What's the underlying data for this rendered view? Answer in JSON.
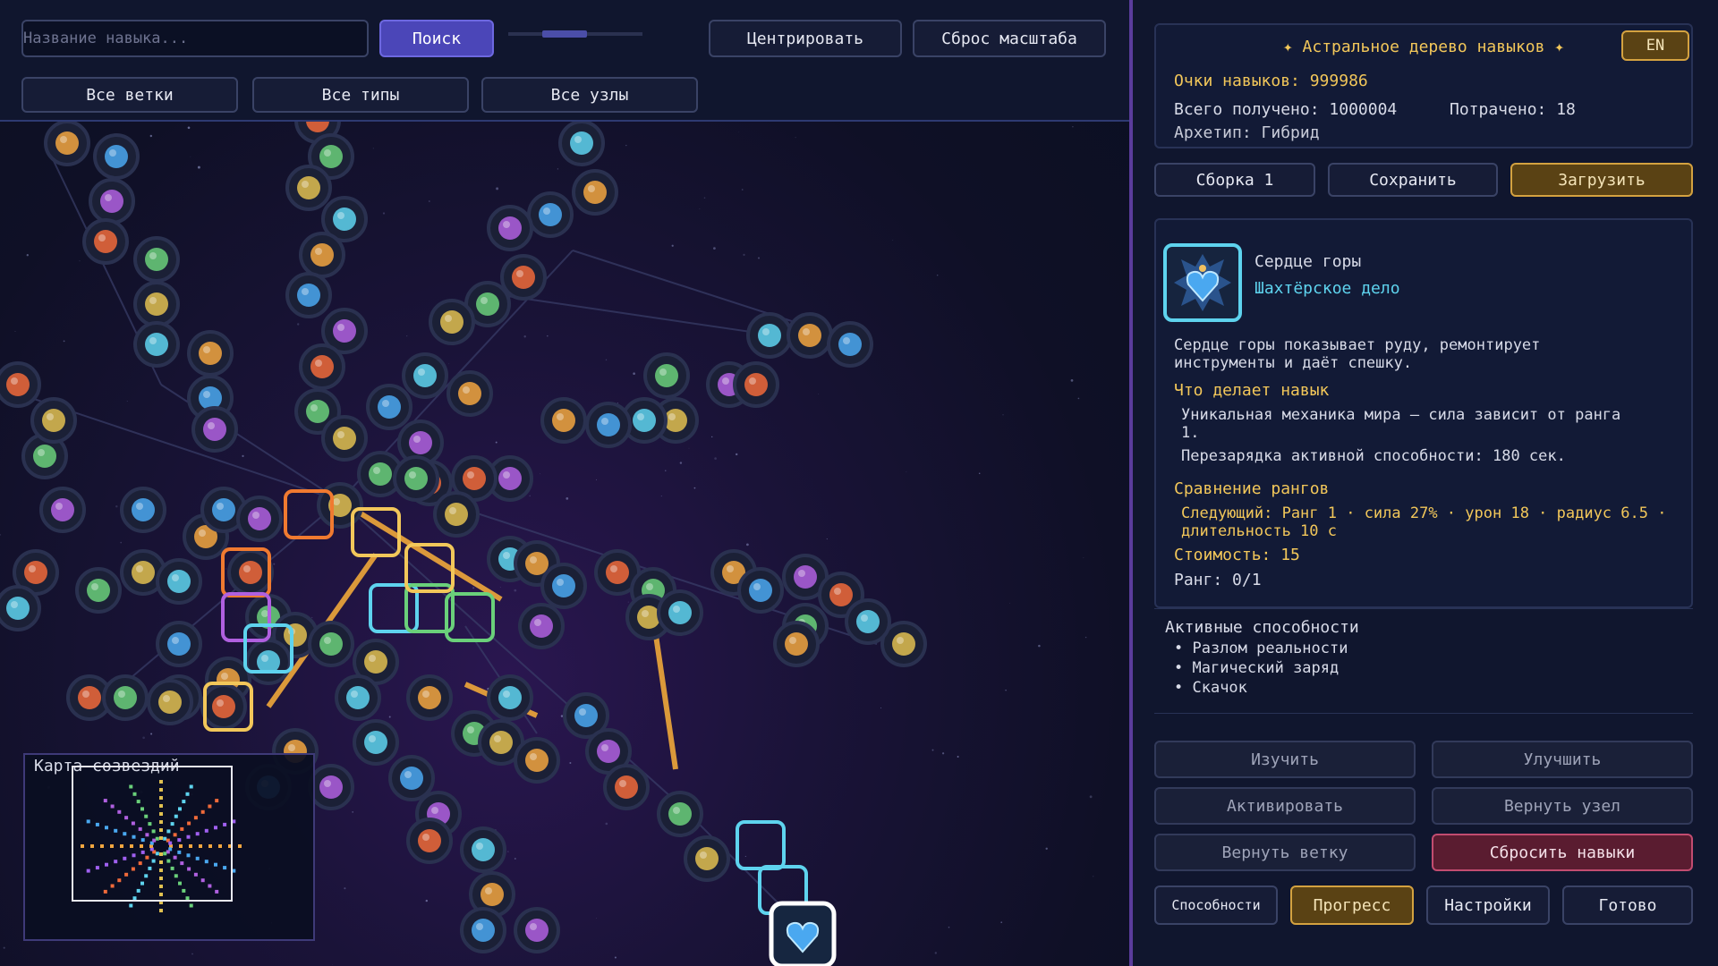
{
  "toolbar": {
    "search_placeholder": "Название навыка...",
    "search_button": "Поиск",
    "center_button": "Центрировать",
    "reset_zoom_button": "Сброс масштаба",
    "filter_branches": "Все ветки",
    "filter_types": "Все типы",
    "filter_nodes": "Все узлы"
  },
  "minimap": {
    "title": "Карта созвездий"
  },
  "header": {
    "title": "✦ Астральное дерево навыков ✦",
    "lang_button": "EN",
    "skill_points": "Очки навыков: 999986",
    "total_earned": "Всего получено: 1000004",
    "spent": "Потрачено: 18",
    "archetype": "Архетип: Гибрид"
  },
  "builds": {
    "build_button": "Сборка 1",
    "save_button": "Сохранить",
    "load_button": "Загрузить"
  },
  "skill": {
    "name": "Сердце горы",
    "branch": "Шахтёрское дело",
    "description": "Сердце горы показывает руду, ремонтирует инструменты и даёт спешку.",
    "what_title": "Что делает навык",
    "what_1": "Уникальная механика мира — сила зависит от ранга 1.",
    "what_2": "Перезарядка активной способности: 180 сек.",
    "compare_title": "Сравнение рангов",
    "compare_next": "Следующий: Ранг 1 · сила 27% · урон 18 · радиус 6.5 · длительность 10 с",
    "cost": "Стоимость: 15",
    "rank": "Ранг: 0/1",
    "icon": "blue-heart-crest-icon"
  },
  "active_abilities": {
    "title": "Активные способности",
    "items": [
      "Разлом реальности",
      "Магический заряд",
      "Скачок"
    ]
  },
  "actions": {
    "learn": "Изучить",
    "upgrade": "Улучшить",
    "activate": "Активировать",
    "refund_node": "Вернуть узел",
    "refund_branch": "Вернуть ветку",
    "reset_skills": "Сбросить навыки"
  },
  "tabs": {
    "abilities": "Способности",
    "progress": "Прогресс",
    "settings": "Настройки",
    "done": "Готово"
  },
  "colors": {
    "accent_gold": "#f2c75a",
    "accent_cyan": "#5ed3ee",
    "search_button": "#4b46b8",
    "danger": "#c24c70",
    "panel_bg": "#10162e"
  }
}
